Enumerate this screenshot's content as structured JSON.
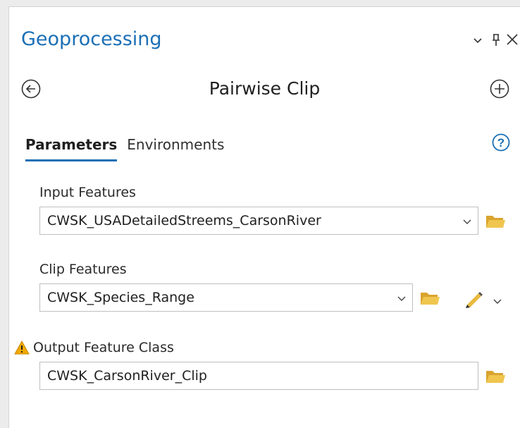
{
  "pane": {
    "title": "Geoprocessing",
    "header_icons": [
      "chevron-down-icon",
      "pin-icon",
      "close-icon"
    ]
  },
  "tool": {
    "title": "Pairwise Clip",
    "back_icon": "back-arrow-circle-icon",
    "add_icon": "plus-circle-icon"
  },
  "tabs": [
    {
      "label": "Parameters",
      "active": true
    },
    {
      "label": "Environments",
      "active": false
    }
  ],
  "help_icon": "help-question-icon",
  "parameters": {
    "input_features": {
      "label": "Input Features",
      "value": "CWSK_USADetailedStreems_CarsonRiver"
    },
    "clip_features": {
      "label": "Clip Features",
      "value": "CWSK_Species_Range"
    },
    "output_feature_class": {
      "label": "Output Feature Class",
      "value": "CWSK_CarsonRiver_Clip",
      "warning_icon": "warning-triangle-icon"
    }
  },
  "colors": {
    "accent": "#1b6fb5",
    "folder": "#e8b93f",
    "warning": "#f2a900"
  }
}
